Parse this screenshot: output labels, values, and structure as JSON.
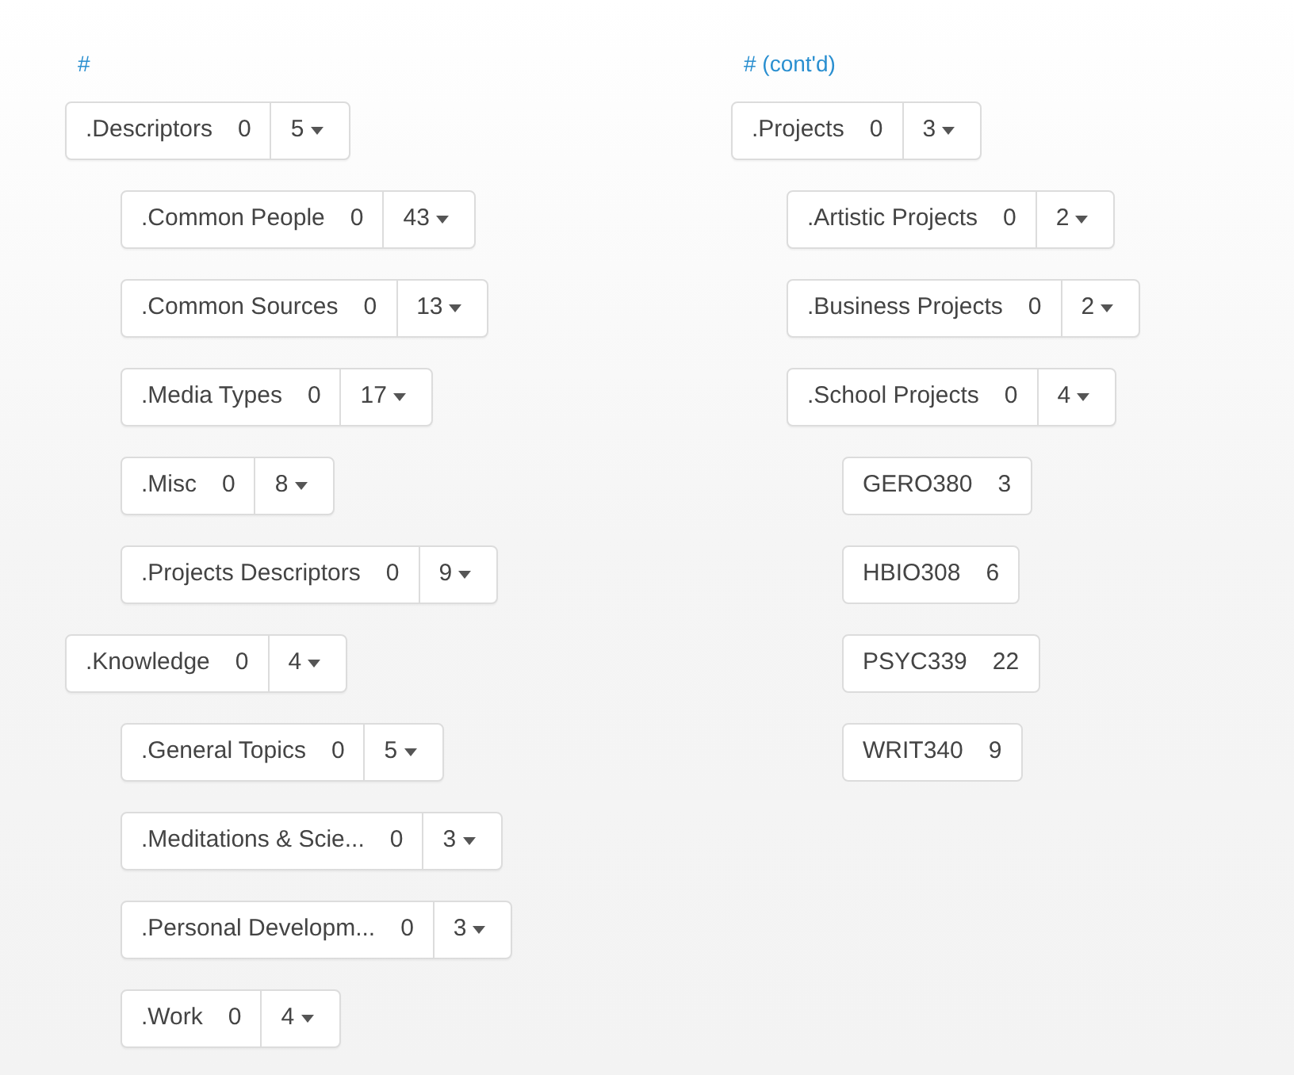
{
  "columns": [
    {
      "heading": "#",
      "items": [
        {
          "kind": "group",
          "name": ".Descriptors",
          "count": "0",
          "total": "5",
          "children": [
            {
              "kind": "group",
              "name": ".Common People",
              "count": "0",
              "total": "43"
            },
            {
              "kind": "group",
              "name": ".Common Sources",
              "count": "0",
              "total": "13"
            },
            {
              "kind": "group",
              "name": ".Media Types",
              "count": "0",
              "total": "17"
            },
            {
              "kind": "group",
              "name": ".Misc",
              "count": "0",
              "total": "8"
            },
            {
              "kind": "group",
              "name": ".Projects Descriptors",
              "count": "0",
              "total": "9"
            }
          ]
        },
        {
          "kind": "group",
          "name": ".Knowledge",
          "count": "0",
          "total": "4",
          "children": [
            {
              "kind": "group",
              "name": ".General Topics",
              "count": "0",
              "total": "5"
            },
            {
              "kind": "group",
              "name": ".Meditations & Scie...",
              "count": "0",
              "total": "3"
            },
            {
              "kind": "group",
              "name": ".Personal Developm...",
              "count": "0",
              "total": "3"
            },
            {
              "kind": "group",
              "name": ".Work",
              "count": "0",
              "total": "4"
            }
          ]
        }
      ]
    },
    {
      "heading": "# (cont'd)",
      "items": [
        {
          "kind": "group",
          "name": ".Projects",
          "count": "0",
          "total": "3",
          "children": [
            {
              "kind": "group",
              "name": ".Artistic Projects",
              "count": "0",
              "total": "2"
            },
            {
              "kind": "group",
              "name": ".Business Projects",
              "count": "0",
              "total": "2"
            },
            {
              "kind": "group",
              "name": ".School Projects",
              "count": "0",
              "total": "4",
              "children": [
                {
                  "kind": "leaf",
                  "name": "GERO380",
                  "count": "3"
                },
                {
                  "kind": "leaf",
                  "name": "HBIO308",
                  "count": "6"
                },
                {
                  "kind": "leaf",
                  "name": "PSYC339",
                  "count": "22"
                },
                {
                  "kind": "leaf",
                  "name": "WRIT340",
                  "count": "9"
                }
              ]
            }
          ]
        }
      ]
    }
  ]
}
